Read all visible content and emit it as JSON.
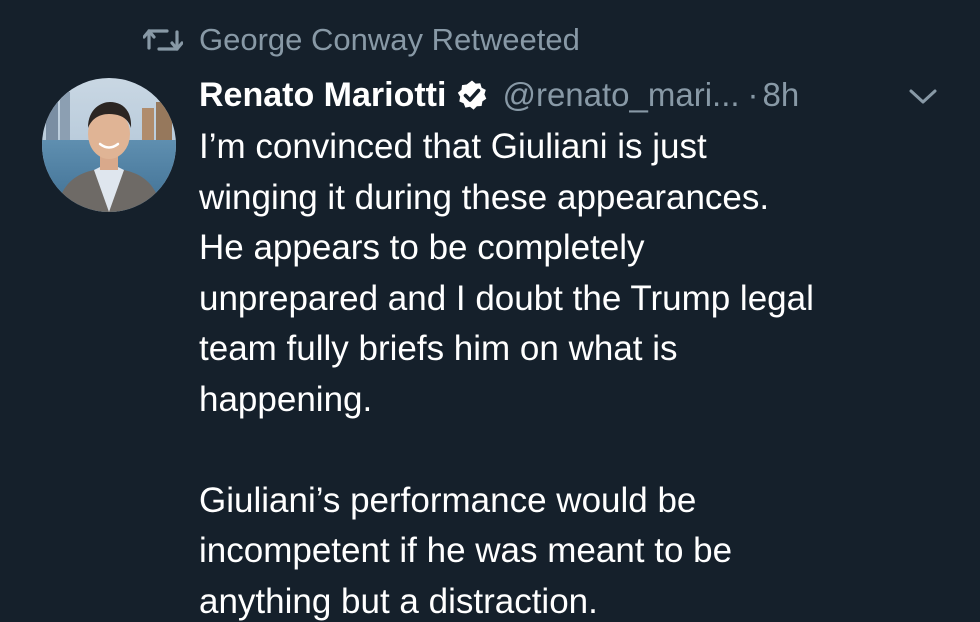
{
  "retweet": {
    "icon": "retweet-icon",
    "text": "George Conway Retweeted"
  },
  "author": {
    "avatar": "avatar-photo",
    "name": "Renato Mariotti",
    "verified_icon": "verified-badge-icon",
    "handle": "@renato_mari...",
    "separator": "·",
    "time": "8h",
    "menu_icon": "chevron-down-icon"
  },
  "tweet": {
    "paragraph1": [
      "I’m convinced that Giuliani is just",
      "winging it during these appearances.",
      "He appears to be completely",
      "unprepared and I doubt the Trump legal",
      "team fully briefs him on what is",
      "happening."
    ],
    "paragraph2": [
      "Giuliani’s performance would be",
      "incompetent if he was meant to be",
      "anything but a distraction."
    ]
  },
  "colors": {
    "background": "#15202b",
    "primary_text": "#ffffff",
    "secondary_text": "#8899a6"
  }
}
